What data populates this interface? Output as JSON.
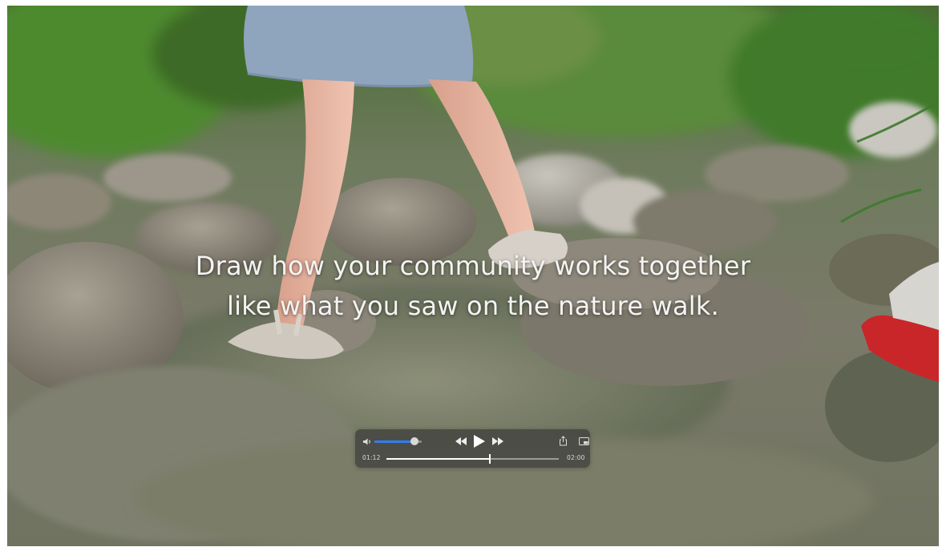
{
  "caption": {
    "line1": "Draw how your community works together",
    "line2": "like what you saw on the nature walk."
  },
  "player": {
    "elapsed": "01:12",
    "total": "02:00",
    "progress": 0.6,
    "volume": 0.85,
    "accent_color": "#2f7ff0",
    "icons": [
      "volume-icon",
      "rewind-icon",
      "play-icon",
      "fast-forward-icon",
      "share-icon",
      "picture-in-picture-icon"
    ]
  }
}
